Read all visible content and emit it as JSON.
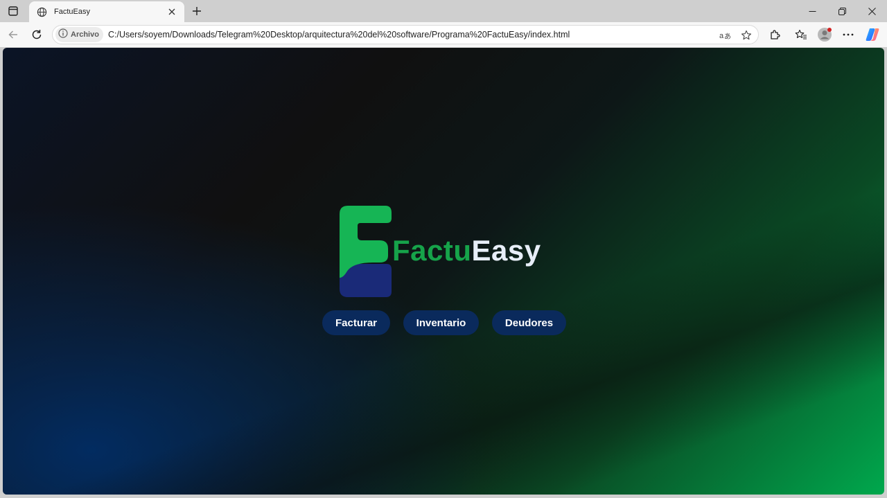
{
  "browser": {
    "tab": {
      "title": "FactuEasy"
    },
    "address_bar": {
      "security_chip": "Archivo",
      "url": "C:/Users/soyem/Downloads/Telegram%20Desktop/arquitectura%20del%20software/Programa%20FactuEasy/index.html"
    },
    "icons": [
      "tab-actions-icon",
      "globe-icon",
      "close-icon",
      "plus-icon",
      "minimize-icon",
      "restore-icon",
      "window-close-icon",
      "back-icon",
      "reload-icon",
      "info-icon",
      "translate-icon",
      "star-icon",
      "extensions-icon",
      "favorites-icon",
      "profile-icon",
      "more-icon",
      "copilot-icon"
    ]
  },
  "page": {
    "brand": {
      "part1": "Factu",
      "part2": "Easy"
    },
    "buttons": [
      "Facturar",
      "Inventario",
      "Deudores"
    ],
    "colors": {
      "accent_green": "#16a34a",
      "logo_navy": "#1a2a78",
      "button_bg": "#0a2a5c"
    }
  }
}
